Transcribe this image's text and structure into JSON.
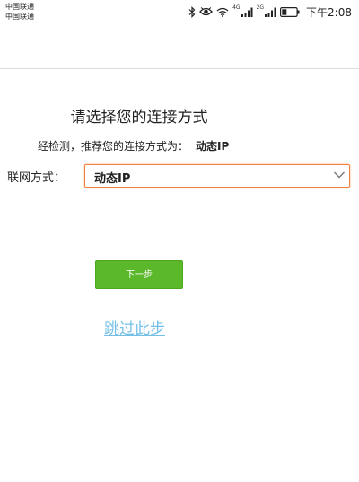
{
  "status_bar": {
    "carrier_1": "中国联通",
    "carrier_2": "中国联通",
    "network_tag_1": "4G",
    "network_tag_2": "2G",
    "time": "下午2:08",
    "icons": [
      "bluetooth-icon",
      "eye-comfort-icon",
      "wifi-icon",
      "signal-icon",
      "signal-icon",
      "battery-icon"
    ]
  },
  "page": {
    "title": "请选择您的连接方式",
    "detect_text": "经检测，推荐您的连接方式为：",
    "detect_value": "动态IP",
    "conn_label": "联网方式：",
    "conn_select_value": "动态IP",
    "next_button": "下一步",
    "skip_link": "跳过此步"
  },
  "colors": {
    "accent_green": "#5cb82b",
    "link_blue": "#73bfe8",
    "focus_orange": "#ef7f3a"
  }
}
